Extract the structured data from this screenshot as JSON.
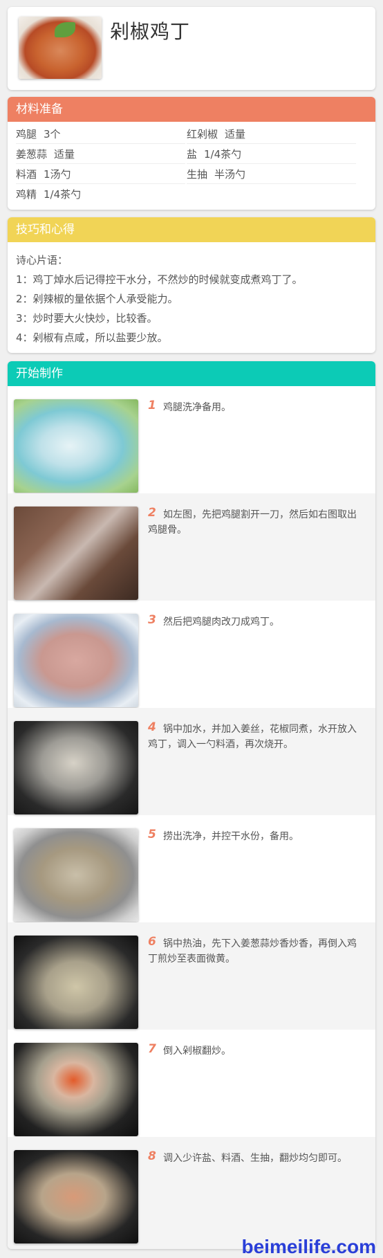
{
  "recipe": {
    "title": "剁椒鸡丁"
  },
  "ingredients": {
    "header": "材料准备",
    "items": [
      {
        "name": "鸡腿",
        "qty": "3个"
      },
      {
        "name": "红剁椒",
        "qty": "适量"
      },
      {
        "name": "姜葱蒜",
        "qty": "适量"
      },
      {
        "name": "盐",
        "qty": "1/4茶勺"
      },
      {
        "name": "料酒",
        "qty": "1汤勺"
      },
      {
        "name": "生抽",
        "qty": "半汤勺"
      },
      {
        "name": "鸡精",
        "qty": "1/4茶勺"
      }
    ]
  },
  "tips": {
    "header": "技巧和心得",
    "lines": [
      "诗心片语：",
      "1：鸡丁焯水后记得控干水分，不然炒的时候就变成煮鸡丁了。",
      "2：剁辣椒的量依据个人承受能力。",
      "3：炒时要大火快炒，比较香。",
      "4：剁椒有点咸，所以盐要少放。"
    ]
  },
  "steps": {
    "header": "开始制作",
    "items": [
      {
        "num": "1",
        "text": "鸡腿洗净备用。"
      },
      {
        "num": "2",
        "text": "如左图，先把鸡腿割开一刀，然后如右图取出鸡腿骨。"
      },
      {
        "num": "3",
        "text": "然后把鸡腿肉改刀成鸡丁。"
      },
      {
        "num": "4",
        "text": "锅中加水，并加入姜丝，花椒同煮，水开放入鸡丁，调入一勺料酒，再次烧开。"
      },
      {
        "num": "5",
        "text": "捞出洗净，并控干水份，备用。"
      },
      {
        "num": "6",
        "text": "锅中热油，先下入姜葱蒜炒香炒香，再倒入鸡丁煎炒至表面微黄。"
      },
      {
        "num": "7",
        "text": "倒入剁椒翻炒。"
      },
      {
        "num": "8",
        "text": "调入少许盐、料酒、生抽，翻炒均匀即可。"
      }
    ]
  },
  "watermark": "beimeilife.com",
  "colors": {
    "ingredients_header": "#ee8062",
    "tips_header": "#f1d456",
    "steps_header": "#0ccbb6",
    "step_number": "#ee8062"
  }
}
